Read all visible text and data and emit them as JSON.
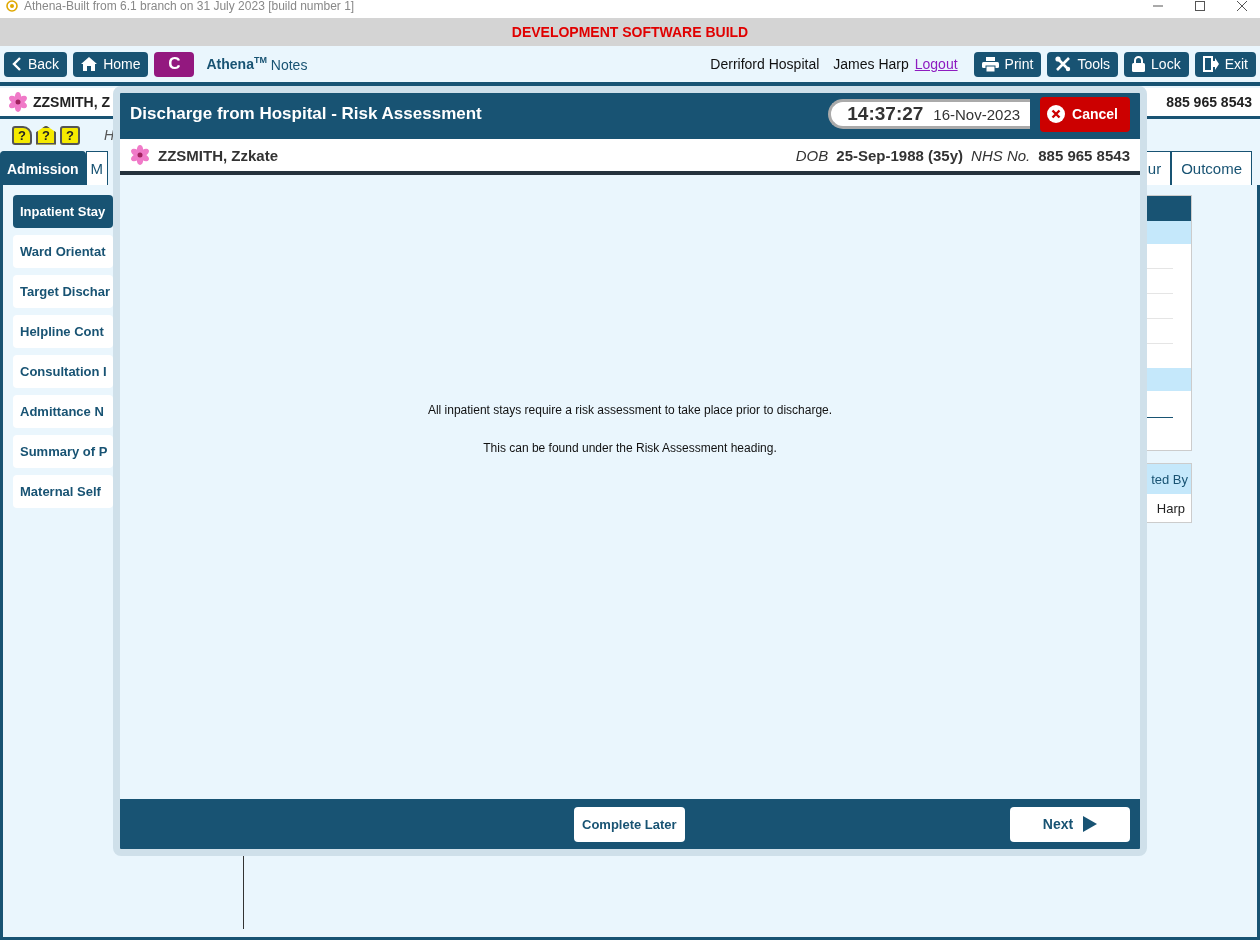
{
  "window": {
    "title": "Athena-Built from 6.1 branch on 31 July 2023 [build number 1]"
  },
  "banner": "DEVELOPMENT SOFTWARE BUILD",
  "toolbar": {
    "left_buttons": [
      {
        "label": "Back",
        "kind": "back"
      },
      {
        "label": "Home",
        "kind": "home"
      },
      {
        "label": "C",
        "kind": "letter"
      }
    ],
    "app_name": "Athena$^{TM}$ Notes",
    "hospital": "Derriford Hospital",
    "user": "James Harp",
    "logout": "Logout",
    "right_buttons": [
      {
        "label": "Print",
        "kind": "print"
      },
      {
        "label": "Tools",
        "kind": "tools"
      },
      {
        "label": "Lock",
        "kind": "lock"
      },
      {
        "label": "Exit",
        "kind": "exit"
      }
    ]
  },
  "patient_bar": {
    "name": "ZZSMITH, Z",
    "nhs_number": "885 965 8543"
  },
  "alert_icons": [
    {
      "kind": "hand",
      "glyph": "?"
    },
    {
      "kind": "house",
      "glyph": "?"
    },
    {
      "kind": "plain",
      "glyph": "?"
    }
  ],
  "alert_text": "H",
  "tabs": [
    {
      "label": "Admission",
      "selected": true
    },
    {
      "label": "M",
      "selected": false
    },
    {
      "label": "ur",
      "selected": false
    },
    {
      "label": "Outcome",
      "selected": false
    }
  ],
  "sidebar": {
    "items": [
      {
        "label": "Inpatient Stay",
        "selected": true
      },
      {
        "label": "Ward Orientat",
        "selected": false
      },
      {
        "label": "Target Dischar",
        "selected": false
      },
      {
        "label": "Helpline Cont",
        "selected": false
      },
      {
        "label": "Consultation I",
        "selected": false
      },
      {
        "label": "Admittance N",
        "selected": false
      },
      {
        "label": "Summary of P",
        "selected": false
      },
      {
        "label": "Maternal Self",
        "selected": false
      }
    ]
  },
  "side_table": {
    "column_heading": "ted By",
    "cell": "Harp"
  },
  "modal": {
    "title": "Discharge from Hospital - Risk Assessment",
    "time": "14:37:27",
    "date": "16-Nov-2023",
    "cancel": "Cancel",
    "patient_name": "ZZSMITH, Zzkate",
    "dob_label": "DOB",
    "dob": "25-Sep-1988 (35y)",
    "nhs_label": "NHS No.",
    "nhs_number": "885 965 8543",
    "messages": [
      "All inpatient stays require a risk assessment to take place prior to discharge.",
      "This can be found under the Risk Assessment heading."
    ],
    "complete_later": "Complete Later",
    "next": "Next"
  }
}
